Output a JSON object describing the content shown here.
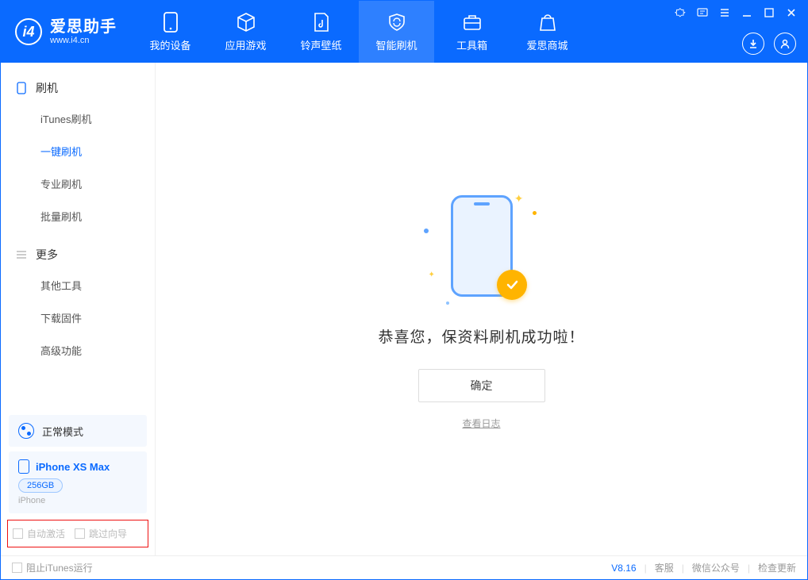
{
  "app": {
    "name_cn": "爱思助手",
    "name_en": "www.i4.cn"
  },
  "nav": {
    "items": [
      {
        "label": "我的设备"
      },
      {
        "label": "应用游戏"
      },
      {
        "label": "铃声壁纸"
      },
      {
        "label": "智能刷机"
      },
      {
        "label": "工具箱"
      },
      {
        "label": "爱思商城"
      }
    ]
  },
  "sidebar": {
    "group1": {
      "title": "刷机"
    },
    "items1": [
      {
        "label": "iTunes刷机"
      },
      {
        "label": "一键刷机"
      },
      {
        "label": "专业刷机"
      },
      {
        "label": "批量刷机"
      }
    ],
    "group2": {
      "title": "更多"
    },
    "items2": [
      {
        "label": "其他工具"
      },
      {
        "label": "下载固件"
      },
      {
        "label": "高级功能"
      }
    ],
    "mode_label": "正常模式",
    "device": {
      "name": "iPhone XS Max",
      "storage": "256GB",
      "type": "iPhone"
    },
    "checks": {
      "auto_activate": "自动激活",
      "skip_guide": "跳过向导"
    }
  },
  "main": {
    "success_title": "恭喜您，保资料刷机成功啦！",
    "ok_button": "确定",
    "view_log": "查看日志"
  },
  "footer": {
    "block_itunes": "阻止iTunes运行",
    "version": "V8.16",
    "links": {
      "service": "客服",
      "wechat": "微信公众号",
      "update": "检查更新"
    }
  }
}
